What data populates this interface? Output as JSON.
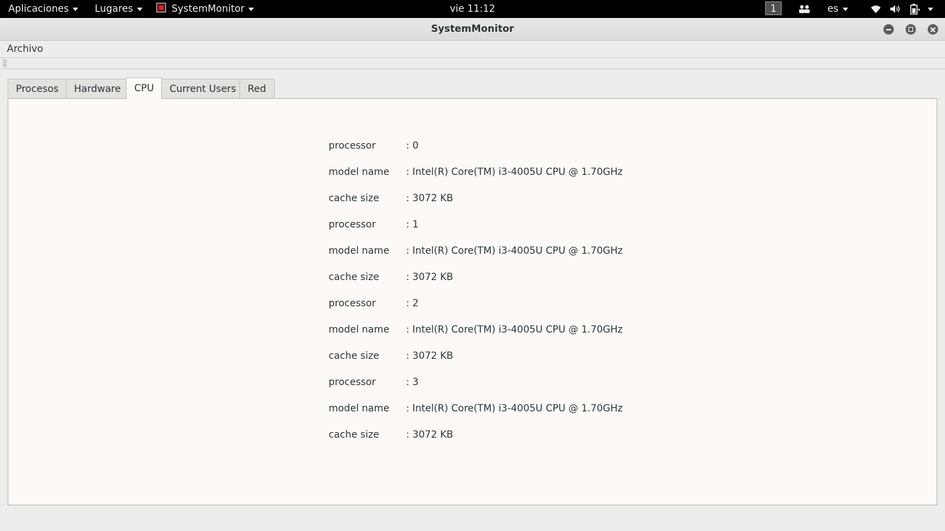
{
  "topbar": {
    "applications": "Aplicaciones",
    "places": "Lugares",
    "app_menu": "SystemMonitor",
    "clock": "vie 11:12",
    "workspace": "1",
    "keyboard_layout": "es"
  },
  "window": {
    "title": "SystemMonitor",
    "menu": {
      "file": "Archivo"
    }
  },
  "tabs": [
    {
      "label": "Procesos"
    },
    {
      "label": "Hardware"
    },
    {
      "label": "CPU",
      "active": true
    },
    {
      "label": "Current Users"
    },
    {
      "label": "Red"
    }
  ],
  "cpu_info": [
    {
      "key": "processor",
      "value": ": 0"
    },
    {
      "key": "model name",
      "value": ": Intel(R) Core(TM) i3-4005U CPU @ 1.70GHz"
    },
    {
      "key": "cache size",
      "value": ": 3072 KB"
    },
    {
      "key": "processor",
      "value": ": 1"
    },
    {
      "key": "model name",
      "value": ": Intel(R) Core(TM) i3-4005U CPU @ 1.70GHz"
    },
    {
      "key": "cache size",
      "value": ": 3072 KB"
    },
    {
      "key": "processor",
      "value": ": 2"
    },
    {
      "key": "model name",
      "value": ": Intel(R) Core(TM) i3-4005U CPU @ 1.70GHz"
    },
    {
      "key": "cache size",
      "value": ": 3072 KB"
    },
    {
      "key": "processor",
      "value": ": 3"
    },
    {
      "key": "model name",
      "value": ": Intel(R) Core(TM) i3-4005U CPU @ 1.70GHz"
    },
    {
      "key": "cache size",
      "value": ": 3072 KB"
    }
  ],
  "colors": {
    "topbar_bg": "#000000",
    "panel_bg": "#fcf9f6",
    "window_bg": "#ededeb",
    "text": "#2e3436"
  }
}
